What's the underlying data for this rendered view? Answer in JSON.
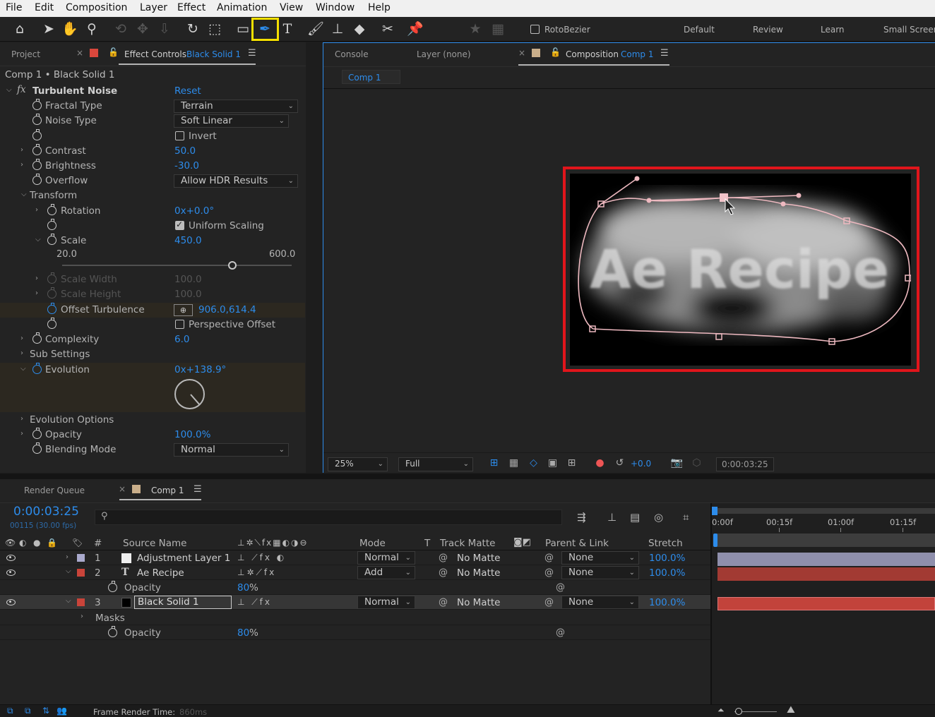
{
  "menu": [
    "File",
    "Edit",
    "Composition",
    "Layer",
    "Effect",
    "Animation",
    "View",
    "Window",
    "Help"
  ],
  "toolbar": {
    "rotobezier_label": "RotoBezier",
    "workspaces": [
      "Default",
      "Review",
      "Learn",
      "Small Screen"
    ],
    "highlight_color": "#f5e000"
  },
  "effect_panel": {
    "project_tab": "Project",
    "tab_label": "Effect Controls",
    "tab_layer": "Black Solid 1",
    "breadcrumb": "Comp 1 • Black Solid 1",
    "effect_name": "Turbulent Noise",
    "reset": "Reset",
    "fractal_type": {
      "label": "Fractal Type",
      "value": "Terrain"
    },
    "noise_type": {
      "label": "Noise Type",
      "value": "Soft Linear"
    },
    "invert": {
      "label": "Invert",
      "checked": false
    },
    "contrast": {
      "label": "Contrast",
      "value": "50.0"
    },
    "brightness": {
      "label": "Brightness",
      "value": "-30.0"
    },
    "overflow": {
      "label": "Overflow",
      "value": "Allow HDR Results"
    },
    "transform": "Transform",
    "rotation": {
      "label": "Rotation",
      "value": "0x+0.0°"
    },
    "uniform_scaling": {
      "label": "Uniform Scaling",
      "checked": true
    },
    "scale": {
      "label": "Scale",
      "value": "450.0",
      "min": "20.0",
      "max": "600.0",
      "fraction": 0.74
    },
    "scale_width": {
      "label": "Scale Width",
      "value": "100.0"
    },
    "scale_height": {
      "label": "Scale Height",
      "value": "100.0"
    },
    "offset_turbulence": {
      "label": "Offset Turbulence",
      "value": "906.0,614.4"
    },
    "perspective_offset": {
      "label": "Perspective Offset",
      "checked": false
    },
    "complexity": {
      "label": "Complexity",
      "value": "6.0"
    },
    "sub_settings": "Sub Settings",
    "evolution": {
      "label": "Evolution",
      "value": "0x+138.9°",
      "angle": 138.9
    },
    "evolution_options": "Evolution Options",
    "opacity": {
      "label": "Opacity",
      "value": "100.0%"
    },
    "blending_mode": {
      "label": "Blending Mode",
      "value": "Normal"
    }
  },
  "viewer": {
    "console_tab": "Console",
    "layer_tab": "Layer (none)",
    "comp_tab_label": "Composition",
    "comp_tab_name": "Comp 1",
    "flow_chip": "Comp 1",
    "canvas_text": "Ae Recipe",
    "highlight_color": "#e0151b",
    "zoom": "25%",
    "resolution": "Full",
    "exposure": "+0.0",
    "timecode": "0:00:03:25"
  },
  "timeline": {
    "render_queue_tab": "Render Queue",
    "comp_tab": "Comp 1",
    "timecode": "0:00:03:25",
    "frames": "00115 (30.00 fps)",
    "search_placeholder": "",
    "columns": {
      "num": "#",
      "source_name": "Source Name",
      "mode": "Mode",
      "t": "T",
      "track_matte": "Track Matte",
      "parent_link": "Parent & Link",
      "stretch": "Stretch"
    },
    "ruler": [
      "0:00f",
      "00:15f",
      "01:00f",
      "01:15f"
    ],
    "layers": [
      {
        "num": "1",
        "name": "Adjustment Layer 1",
        "mode": "Normal",
        "matte": "No Matte",
        "parent": "None",
        "stretch": "100.0%",
        "label_color": "#a9a9cc"
      },
      {
        "num": "2",
        "name": "Ae Recipe",
        "mode": "Add",
        "matte": "No Matte",
        "parent": "None",
        "stretch": "100.0%",
        "label_color": "#c9443a"
      },
      {
        "num": "3",
        "name": "Black Solid 1",
        "mode": "Normal",
        "matte": "No Matte",
        "parent": "None",
        "stretch": "100.0%",
        "label_color": "#c9443a"
      }
    ],
    "layer2_opacity": {
      "label": "Opacity",
      "value": "80",
      "unit": "%"
    },
    "masks_label": "Masks",
    "layer3_opacity": {
      "label": "Opacity",
      "value": "80",
      "unit": "%"
    },
    "frame_render_label": "Frame Render Time:",
    "frame_render_value": "860ms"
  }
}
